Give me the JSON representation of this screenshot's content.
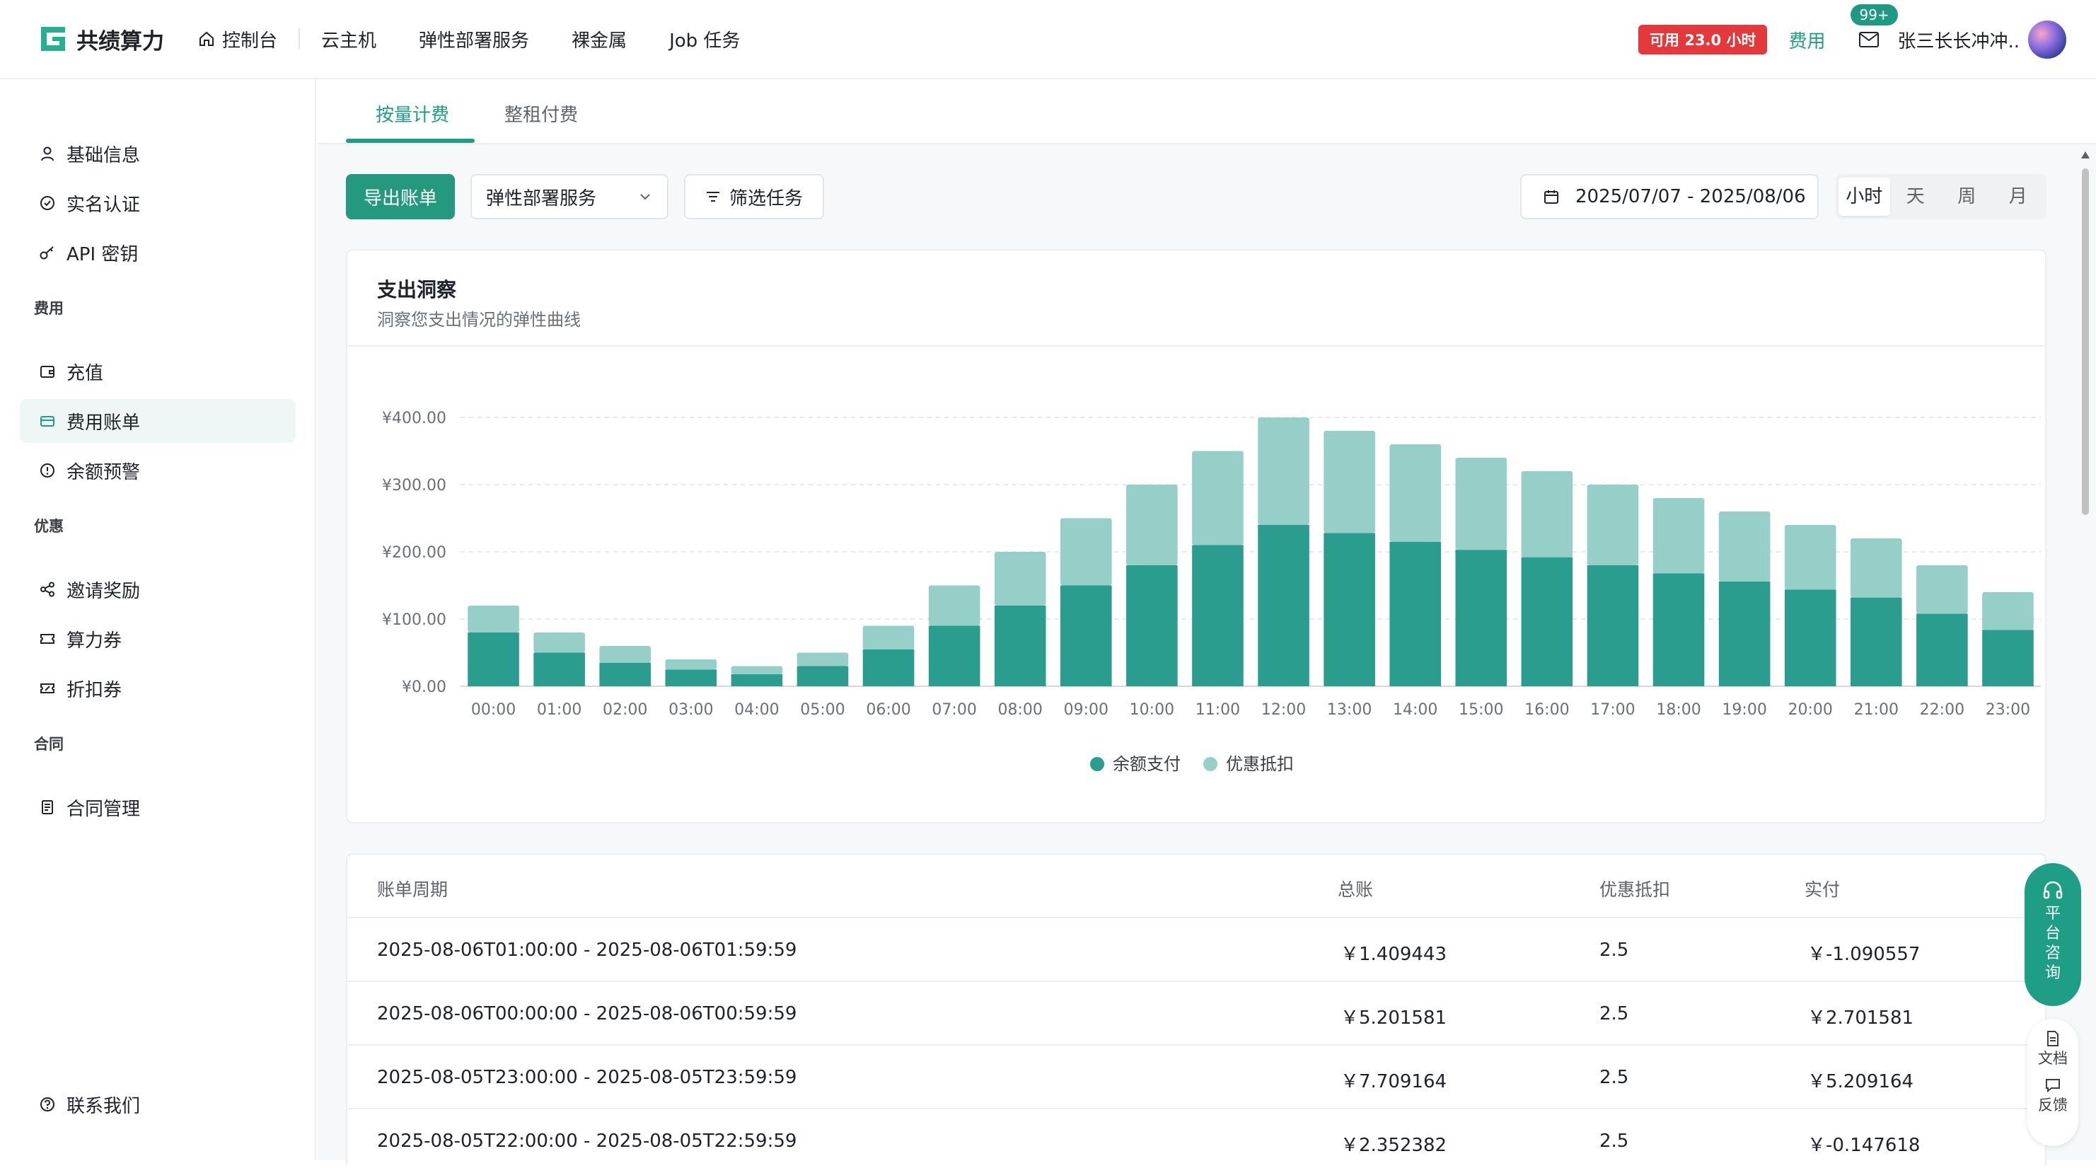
{
  "header": {
    "logo_text": "共绩算力",
    "nav": [
      "控制台",
      "云主机",
      "弹性部署服务",
      "裸金属",
      "Job 任务"
    ],
    "available_badge": "可用 23.0 小时",
    "fee_link": "费用",
    "mail_badge": "99+",
    "user_name": "张三长长冲冲.."
  },
  "sidebar": {
    "items_top": [
      "基础信息",
      "实名认证",
      "API 密钥"
    ],
    "group_fee": "费用",
    "items_fee": [
      "充值",
      "费用账单",
      "余额预警"
    ],
    "group_promo": "优惠",
    "items_promo": [
      "邀请奖励",
      "算力券",
      "折扣券"
    ],
    "group_contract": "合同",
    "items_contract": [
      "合同管理"
    ],
    "contact": "联系我们"
  },
  "tabs": [
    "按量计费",
    "整租付费"
  ],
  "toolbar": {
    "export": "导出账单",
    "service_select": "弹性部署服务",
    "filter": "筛选任务",
    "date_range": "2025/07/07 - 2025/08/06",
    "granularity": [
      "小时",
      "天",
      "周",
      "月"
    ]
  },
  "chart_card": {
    "title": "支出洞察",
    "subtitle": "洞察您支出情况的弹性曲线"
  },
  "chart_data": {
    "type": "bar",
    "stacked": true,
    "categories": [
      "00:00",
      "01:00",
      "02:00",
      "03:00",
      "04:00",
      "05:00",
      "06:00",
      "07:00",
      "08:00",
      "09:00",
      "10:00",
      "11:00",
      "12:00",
      "13:00",
      "14:00",
      "15:00",
      "16:00",
      "17:00",
      "18:00",
      "19:00",
      "20:00",
      "21:00",
      "22:00",
      "23:00"
    ],
    "series": [
      {
        "name": "余额支付",
        "color": "#2a9d8f",
        "values": [
          80,
          50,
          35,
          25,
          18,
          30,
          55,
          90,
          120,
          150,
          180,
          210,
          240,
          228,
          215,
          203,
          192,
          180,
          168,
          156,
          144,
          132,
          108,
          84
        ]
      },
      {
        "name": "优惠抵扣",
        "color": "#95cfc7",
        "values": [
          40,
          30,
          25,
          15,
          12,
          20,
          35,
          60,
          80,
          100,
          120,
          140,
          160,
          152,
          145,
          137,
          128,
          120,
          112,
          104,
          96,
          88,
          72,
          56
        ]
      }
    ],
    "yticks": [
      "¥0.00",
      "¥100.00",
      "¥200.00",
      "¥300.00",
      "¥400.00"
    ],
    "ylim": [
      0,
      400
    ],
    "grid": true,
    "legend_position": "bottom"
  },
  "table": {
    "headers": [
      "账单周期",
      "总账",
      "优惠抵扣",
      "实付"
    ],
    "rows": [
      [
        "2025-08-06T01:00:00 - 2025-08-06T01:59:59",
        "￥1.409443",
        "2.5",
        "￥-1.090557"
      ],
      [
        "2025-08-06T00:00:00 - 2025-08-06T00:59:59",
        "￥5.201581",
        "2.5",
        "￥2.701581"
      ],
      [
        "2025-08-05T23:00:00 - 2025-08-05T23:59:59",
        "￥7.709164",
        "2.5",
        "￥5.209164"
      ],
      [
        "2025-08-05T22:00:00 - 2025-08-05T22:59:59",
        "￥2.352382",
        "2.5",
        "￥-0.147618"
      ]
    ]
  },
  "float": {
    "consult": [
      "平",
      "台",
      "咨",
      "询"
    ],
    "docs": "文档",
    "feedback": "反馈"
  }
}
